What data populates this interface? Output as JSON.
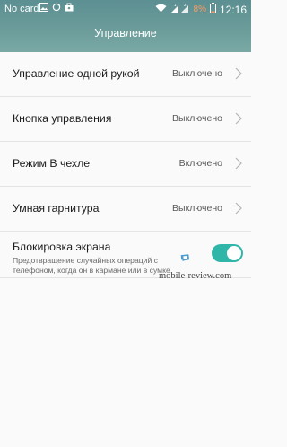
{
  "statusbar": {
    "carrier": "No card",
    "battery_percent": "8%",
    "time": "12:16",
    "sim_labels": [
      "1",
      "2"
    ],
    "accent_battery": "#ff9a60"
  },
  "header": {
    "title": "Управление"
  },
  "settings": [
    {
      "label": "Управление одной рукой",
      "value": "Выключено"
    },
    {
      "label": "Кнопка управления",
      "value": "Выключено"
    },
    {
      "label": "Режим В чехле",
      "value": "Включено"
    },
    {
      "label": "Умная гарнитура",
      "value": "Выключено"
    }
  ],
  "screen_lock": {
    "label": "Блокировка экрана",
    "description": "Предотвращение случайных операций с телефоном, когда он в кармане или в сумке",
    "enabled": true,
    "toggle_color": "#2fb6a9"
  },
  "watermark": {
    "text": "mobile-review.com"
  },
  "icons": [
    "image-icon",
    "sync-icon",
    "bag-icon",
    "wifi-icon",
    "signal-icon",
    "battery-icon",
    "chevron-right-icon"
  ]
}
